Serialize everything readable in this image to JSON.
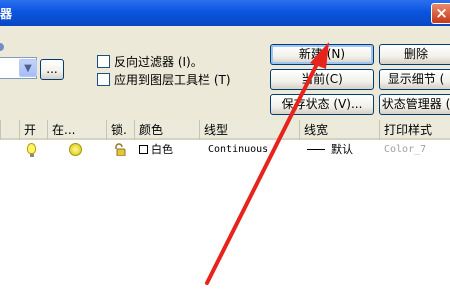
{
  "window": {
    "title": "器",
    "close_glyph": "×"
  },
  "filter": {
    "browse_label": "...",
    "invert_filter_label": "反向过滤器 (I)。",
    "apply_toolbar_label": "应用到图层工具栏 (T)"
  },
  "buttons": {
    "new": "新建 (N)",
    "delete": "删除",
    "current": "当前(C)",
    "show_details": "显示细节 (",
    "save_state": "保存状态 (V)...",
    "state_manager": "状态管理器 ("
  },
  "table": {
    "columns": [
      "开",
      "在...",
      "锁.",
      "颜色",
      "线型",
      "线宽",
      "打印样式"
    ],
    "rows": [
      {
        "color": "白色",
        "linetype": "Continuous",
        "lineweight": "默认",
        "plot_style": "Color_7"
      }
    ]
  },
  "colors": {
    "titlebar": "#0a55e0",
    "dialog_bg": "#ece9d8",
    "arrow": "#e8231c"
  }
}
